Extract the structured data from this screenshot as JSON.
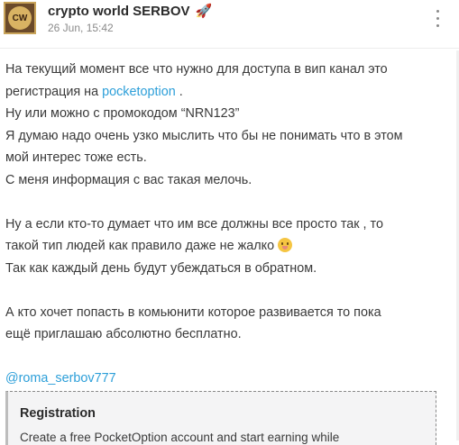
{
  "post": {
    "channel_name": "crypto world SERBOV",
    "channel_emoji": "🚀",
    "avatar_text": "CW",
    "date": "26 Jun, 15:42"
  },
  "message": {
    "p1_line1": "На текущий момент все что нужно для доступа в вип канал это",
    "p1_line2_prefix": "регистрация на ",
    "p1_link": "pocketoption",
    "p1_line2_suffix": " .",
    "p1_line3": "Ну или можно с промокодом “NRN123”",
    "p1_line4": "Я думаю надо очень узко мыслить что бы не понимать что в этом",
    "p1_line5": "мой интерес тоже есть.",
    "p1_line6": "С меня информация с вас такая мелочь.",
    "p2_line1": "Ну а если кто-то думает что им все должны все просто так , то",
    "p2_line2": "такой тип людей как правило даже не жалко ",
    "p2_line3": "Так как каждый день будут убеждаться в обратном.",
    "p3_line1": "А кто хочет попасть в комьюнити которое развивается то пока",
    "p3_line2": "ещё приглашаю абсолютно бесплатно.",
    "mention": "@roma_serbov777"
  },
  "link_preview": {
    "title": "Registration",
    "description": "Create a free PocketOption account and start earning while"
  },
  "colors": {
    "link": "#2d9fd9",
    "text": "#3a3a3a",
    "meta": "#8a8a8a"
  }
}
